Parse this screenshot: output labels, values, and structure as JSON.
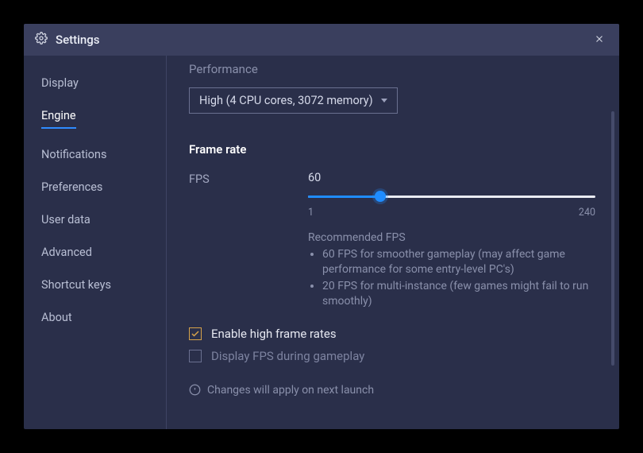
{
  "window": {
    "title": "Settings"
  },
  "sidebar": {
    "items": [
      {
        "label": "Display"
      },
      {
        "label": "Engine"
      },
      {
        "label": "Notifications"
      },
      {
        "label": "Preferences"
      },
      {
        "label": "User data"
      },
      {
        "label": "Advanced"
      },
      {
        "label": "Shortcut keys"
      },
      {
        "label": "About"
      }
    ],
    "active_index": 1
  },
  "performance": {
    "section_label": "Performance",
    "dropdown_value": "High (4 CPU cores, 3072 memory)"
  },
  "frame_rate": {
    "section_head": "Frame rate",
    "fps_label": "FPS",
    "fps_value": "60",
    "min": "1",
    "max": "240",
    "recommended_head": "Recommended FPS",
    "recs": [
      "60 FPS for smoother gameplay (may affect game performance for some entry-level PC's)",
      "20 FPS for multi-instance (few games might fail to run smoothly)"
    ]
  },
  "checkboxes": {
    "enable_high_fps": {
      "label": "Enable high frame rates",
      "checked": true
    },
    "display_fps": {
      "label": "Display FPS during gameplay",
      "checked": false
    }
  },
  "notice": "Changes will apply on next launch"
}
